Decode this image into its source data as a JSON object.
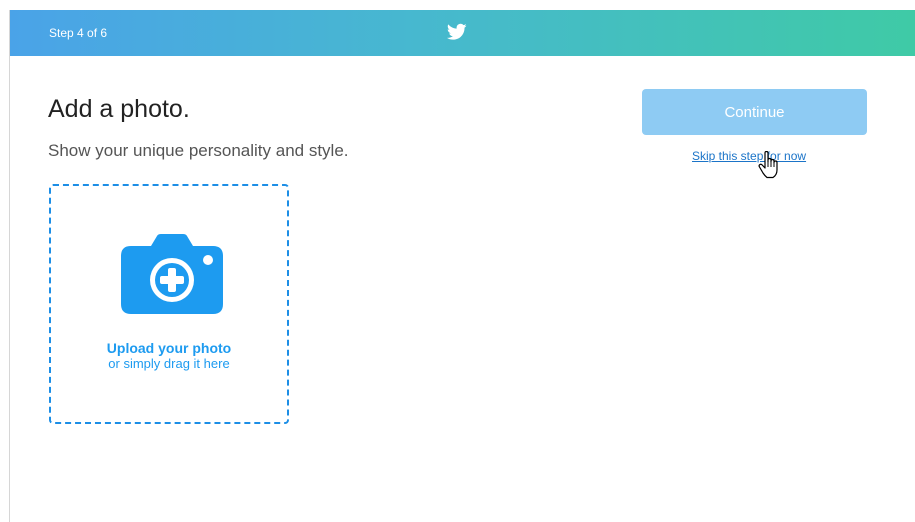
{
  "header": {
    "step_label": "Step 4 of 6",
    "logo_icon": "twitter-bird-icon",
    "gradient": [
      "#4aa3e8",
      "#3fcaa6"
    ]
  },
  "main": {
    "title": "Add a photo.",
    "subtitle": "Show your unique personality and style."
  },
  "upload": {
    "icon": "camera-add-icon",
    "primary_label": "Upload your photo",
    "secondary_label": "or simply drag it here",
    "accent_color": "#1d9bf0"
  },
  "actions": {
    "continue_label": "Continue",
    "continue_state": "disabled",
    "skip_label": "Skip this step for now"
  },
  "cursor": {
    "icon": "hand-pointer-cursor-icon"
  }
}
